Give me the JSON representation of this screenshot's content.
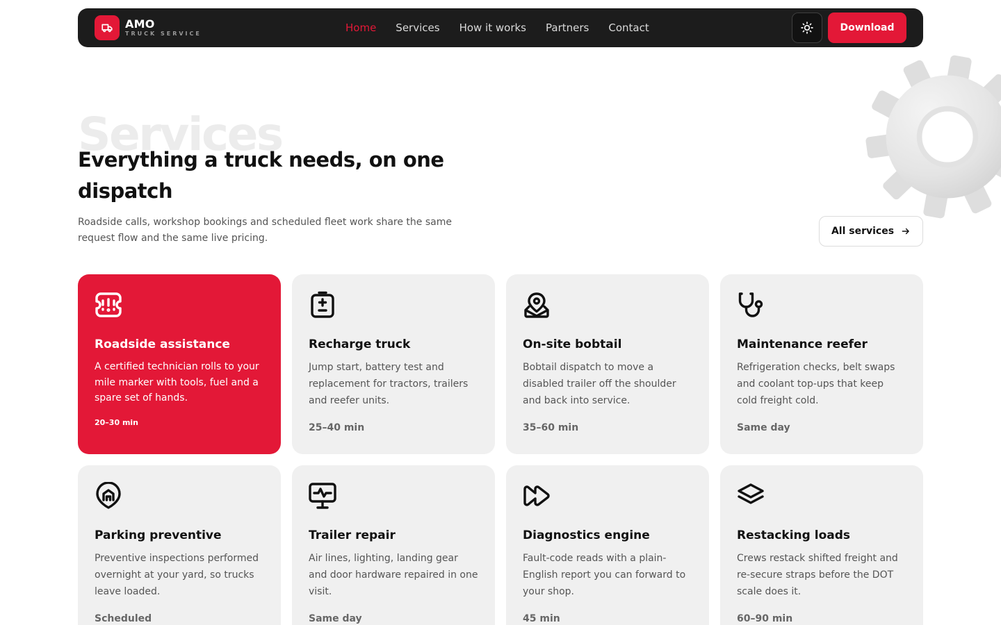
{
  "colors": {
    "accent": "#e31837",
    "nav_bg": "#1c1c1c",
    "card_bg": "#f0f0f0",
    "text": "#111111",
    "muted": "#555555"
  },
  "brand": {
    "name": "AMO",
    "tagline": "TRUCK SERVICE",
    "icon": "truck-icon"
  },
  "nav": {
    "links": [
      {
        "label": "Home",
        "active": true
      },
      {
        "label": "Services",
        "active": false
      },
      {
        "label": "How it works",
        "active": false
      },
      {
        "label": "Partners",
        "active": false
      },
      {
        "label": "Contact",
        "active": false
      }
    ],
    "theme_icon": "sun-icon",
    "download_label": "Download"
  },
  "hero": {
    "watermark": "Services",
    "heading": "Everything a truck needs, on one dispatch",
    "subtext": "Roadside calls, workshop bookings and scheduled fleet work share the same request flow and the same live pricing.",
    "all_services_label": "All services"
  },
  "services": [
    {
      "icon": "alert-ticket-icon",
      "title": "Roadside assistance",
      "desc": "A certified technician rolls to your mile marker with tools, fuel and a spare set of hands.",
      "time": "20–30 min",
      "featured": true
    },
    {
      "icon": "battery-icon",
      "title": "Recharge truck",
      "desc": "Jump start, battery test and replacement for tractors, trailers and reefer units.",
      "time": "25–40 min",
      "featured": false
    },
    {
      "icon": "map-pin-icon",
      "title": "On-site bobtail",
      "desc": "Bobtail dispatch to move a disabled trailer off the shoulder and back into service.",
      "time": "35–60 min",
      "featured": false
    },
    {
      "icon": "stethoscope-icon",
      "title": "Maintenance reefer",
      "desc": "Refrigeration checks, belt swaps and coolant top-ups that keep cold freight cold.",
      "time": "Same day",
      "featured": false
    },
    {
      "icon": "home-pin-icon",
      "title": "Parking preventive",
      "desc": "Preventive inspections performed overnight at your yard, so trucks leave loaded.",
      "time": "Scheduled",
      "featured": false
    },
    {
      "icon": "monitor-pulse-icon",
      "title": "Trailer repair",
      "desc": "Air lines, lighting, landing gear and door hardware repaired in one visit.",
      "time": "Same day",
      "featured": false
    },
    {
      "icon": "fast-forward-icon",
      "title": "Diagnostics engine",
      "desc": "Fault-code reads with a plain-English report you can forward to your shop.",
      "time": "45 min",
      "featured": false
    },
    {
      "icon": "layers-icon",
      "title": "Restacking loads",
      "desc": "Crews restack shifted freight and re-secure straps before the DOT scale does it.",
      "time": "60–90 min",
      "featured": false
    }
  ]
}
